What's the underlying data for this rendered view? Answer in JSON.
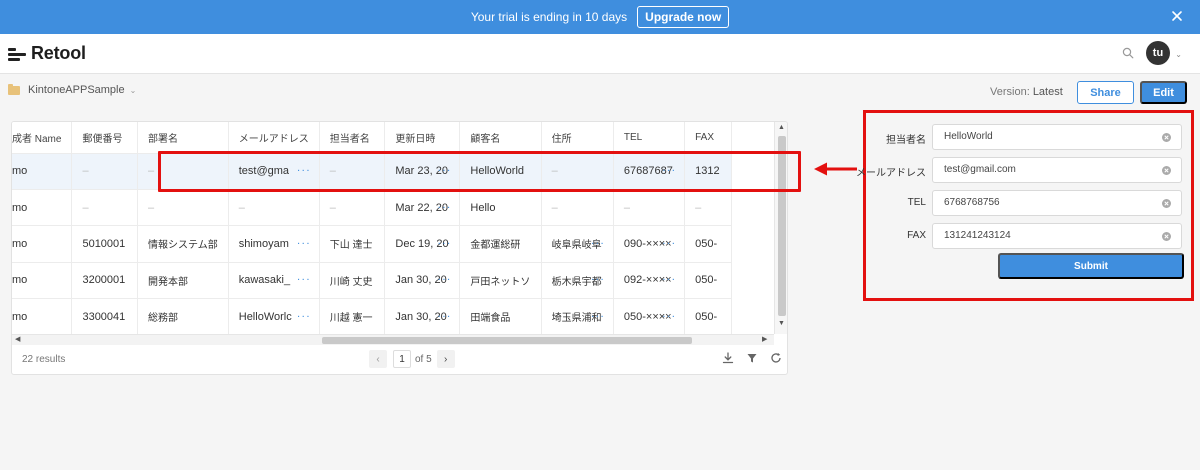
{
  "banner": {
    "text": "Your trial is ending in 10 days",
    "upgrade_label": "Upgrade now"
  },
  "header": {
    "logo_text": "Retool",
    "avatar_initials": "tu"
  },
  "subheader": {
    "app_name": "KintoneAPPSample",
    "version_label": "Version:",
    "version_value": "Latest",
    "share_label": "Share",
    "edit_label": "Edit"
  },
  "table": {
    "columns": [
      "成者 Name",
      "郵便番号",
      "部署名",
      "メールアドレス",
      "担当者名",
      "更新日時",
      "顧客名",
      "住所",
      "TEL",
      "FAX"
    ],
    "rows": [
      [
        "mo",
        "–",
        "–",
        "test@gma",
        "–",
        "Mar 23, 20",
        "HelloWorld",
        "–",
        "67687687",
        "1312"
      ],
      [
        "mo",
        "–",
        "–",
        "–",
        "–",
        "Mar 22, 20",
        "Hello",
        "–",
        "–",
        "–"
      ],
      [
        "mo",
        "5010001",
        "情報システム部",
        "shimoyam",
        "下山 達士",
        "Dec 19, 20",
        "金都運総研",
        "岐阜県岐阜",
        "090-××××",
        "050-"
      ],
      [
        "mo",
        "3200001",
        "開発本部",
        "kawasaki_",
        "川崎 丈史",
        "Jan 30, 20",
        "戸田ネットソ",
        "栃木県宇都",
        "092-××××",
        "050-"
      ],
      [
        "mo",
        "3300041",
        "総務部",
        "HelloWorlc",
        "川越 憲一",
        "Jan 30, 20",
        "田端食品",
        "埼玉県浦和",
        "050-××××",
        "050-"
      ]
    ],
    "more_glyph": "···",
    "results_text": "22 results",
    "page_current": "1",
    "page_of": "of 5"
  },
  "form": {
    "fields": [
      {
        "label": "担当者名",
        "value": "HelloWorld"
      },
      {
        "label": "メールアドレス",
        "value": "test@gmail.com"
      },
      {
        "label": "TEL",
        "value": "6768768756"
      },
      {
        "label": "FAX",
        "value": "131241243124"
      }
    ],
    "submit_label": "Submit"
  },
  "colors": {
    "accent": "#3f8ede",
    "highlight": "#e3100f",
    "selected_row": "#eef4fb"
  },
  "icons": [
    "close-icon",
    "search-icon",
    "chevron-down-icon",
    "folder-icon",
    "download-icon",
    "filter-icon",
    "refresh-icon",
    "clear-icon",
    "arrow-left-icon"
  ]
}
